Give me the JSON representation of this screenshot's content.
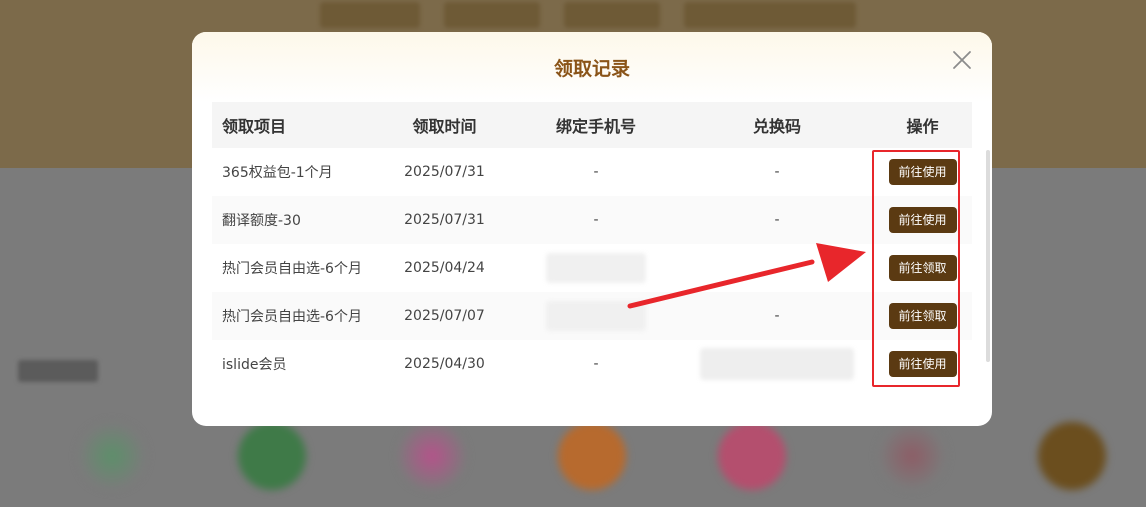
{
  "modal": {
    "title": "领取记录",
    "close_icon": "close-icon"
  },
  "table": {
    "headers": [
      "领取项目",
      "领取时间",
      "绑定手机号",
      "兑换码",
      "操作"
    ],
    "rows": [
      {
        "item": "365权益包-1个月",
        "time": "2025/07/31",
        "phone": "-",
        "code": "-",
        "action": "前往使用"
      },
      {
        "item": "翻译额度-30",
        "time": "2025/07/31",
        "phone": "-",
        "code": "-",
        "action": "前往使用"
      },
      {
        "item": "热门会员自由选-6个月",
        "time": "2025/04/24",
        "phone": "",
        "code": "",
        "action": "前往领取"
      },
      {
        "item": "热门会员自由选-6个月",
        "time": "2025/07/07",
        "phone": "",
        "code": "-",
        "action": "前往领取"
      },
      {
        "item": "islide会员",
        "time": "2025/04/30",
        "phone": "-",
        "code": "",
        "action": "前往使用"
      }
    ]
  },
  "colors": {
    "title": "#8a5418",
    "button_bg": "#5b3a12",
    "annotation": "#e8262b"
  }
}
